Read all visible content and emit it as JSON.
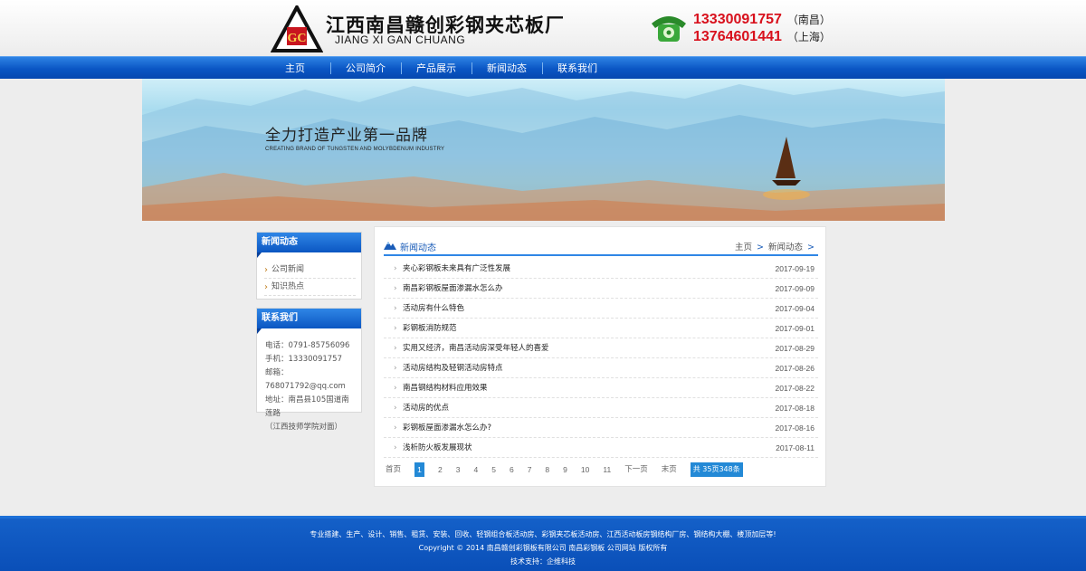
{
  "header": {
    "company_name": "江西南昌赣创彩钢夹芯板厂",
    "company_en": "JIANG XI GAN CHUANG",
    "logo_text": "GC",
    "phones": [
      {
        "number": "13330091757",
        "city": "（南昌）"
      },
      {
        "number": "13764601441",
        "city": "（上海）"
      }
    ]
  },
  "nav": {
    "items": [
      "主页",
      "公司简介",
      "产品展示",
      "新闻动态",
      "联系我们"
    ]
  },
  "banner": {
    "title": "全力打造产业第一品牌",
    "subtitle": "CREATING BRAND OF TUNGSTEN AND MOLYBDENUM INDUSTRY"
  },
  "sidebar": {
    "news": {
      "title": "新闻动态",
      "items": [
        "公司新闻",
        "知识热点"
      ]
    },
    "contact": {
      "title": "联系我们",
      "lines": [
        "电话：0791-85756096",
        "手机：13330091757",
        "邮箱：768071792@qq.com",
        "地址：南昌县105国道南莲路",
        "（江西技师学院对面）"
      ]
    }
  },
  "main": {
    "title": "新闻动态",
    "breadcrumb": {
      "home": "主页",
      "sep": ">",
      "current": "新闻动态"
    },
    "news": [
      {
        "title": "夹心彩钢板未来具有广泛性发展",
        "date": "2017-09-19"
      },
      {
        "title": "南昌彩钢板屋面渗漏水怎么办",
        "date": "2017-09-09"
      },
      {
        "title": "活动房有什么特色",
        "date": "2017-09-04"
      },
      {
        "title": "彩钢板消防规范",
        "date": "2017-09-01"
      },
      {
        "title": "实用又经济，南昌活动房深受年轻人的喜爱",
        "date": "2017-08-29"
      },
      {
        "title": "活动房结构及轻钢活动房特点",
        "date": "2017-08-26"
      },
      {
        "title": "南昌钢结构材料应用效果",
        "date": "2017-08-22"
      },
      {
        "title": "活动房的优点",
        "date": "2017-08-18"
      },
      {
        "title": "彩钢板屋面渗漏水怎么办?",
        "date": "2017-08-16"
      },
      {
        "title": "浅析防火板发展现状",
        "date": "2017-08-11"
      }
    ],
    "pager": {
      "first": "首页",
      "pages": [
        "1",
        "2",
        "3",
        "4",
        "5",
        "6",
        "7",
        "8",
        "9",
        "10",
        "11"
      ],
      "current": "1",
      "next": "下一页",
      "last": "末页",
      "total": "共 35页348条"
    }
  },
  "footer": {
    "line1": "专业搭建、生产、设计、销售、租赁、安装、回收、轻钢组合板活动房、彩钢夹芯板活动房、江西活动板房钢结构厂房、钢结构大棚、楼顶加层等!",
    "line2": "Copyright © 2014 南昌赣创彩钢板有限公司 南昌彩钢板 公司网站 版权所有",
    "line3": "技术支持：企维科技"
  },
  "colors": {
    "nav_blue": "#0a56c4",
    "phone_red": "#d8101c",
    "pager_blue": "#2389d6",
    "footer_blue": "#0a4fb8"
  }
}
